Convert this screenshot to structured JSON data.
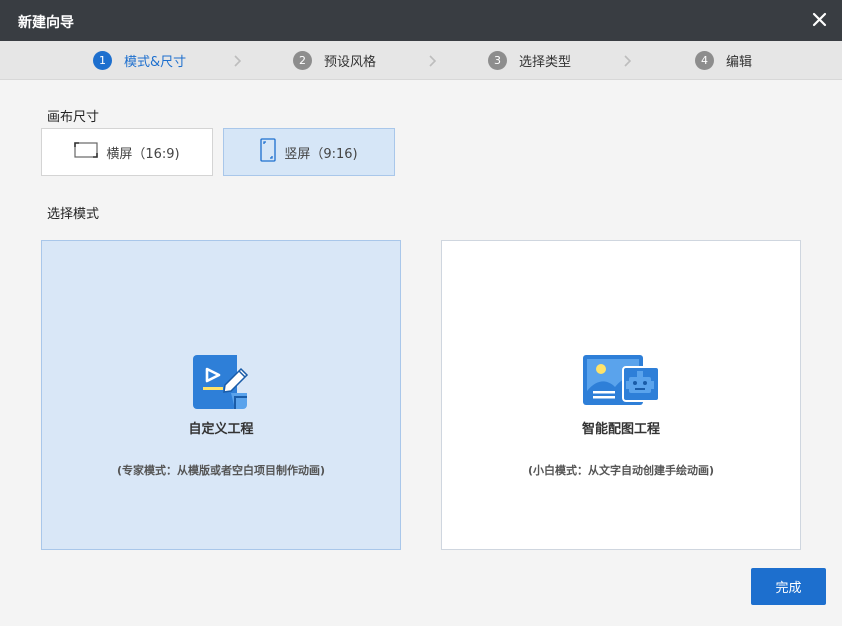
{
  "window": {
    "title": "新建向导"
  },
  "steps": [
    {
      "num": "1",
      "label": "模式&尺寸",
      "active": true
    },
    {
      "num": "2",
      "label": "预设风格",
      "active": false
    },
    {
      "num": "3",
      "label": "选择类型",
      "active": false
    },
    {
      "num": "4",
      "label": "编辑",
      "active": false
    }
  ],
  "canvas_size": {
    "label": "画布尺寸",
    "options": [
      {
        "label": "横屏（16:9)",
        "icon": "landscape-icon",
        "selected": false
      },
      {
        "label": "竖屏（9:16)",
        "icon": "portrait-icon",
        "selected": true
      }
    ]
  },
  "mode": {
    "label": "选择模式",
    "cards": [
      {
        "name": "自定义工程",
        "desc": "(专家模式：从模版或者空白项目制作动画)",
        "icon": "custom-project-icon",
        "selected": true
      },
      {
        "name": "智能配图工程",
        "desc": "(小白模式：从文字自动创建手绘动画)",
        "icon": "smart-illustration-icon",
        "selected": false
      }
    ]
  },
  "footer": {
    "finish_label": "完成"
  },
  "colors": {
    "accent": "#1d6fce",
    "selected_bg": "#d9e7f7",
    "titlebar": "#393d42"
  }
}
